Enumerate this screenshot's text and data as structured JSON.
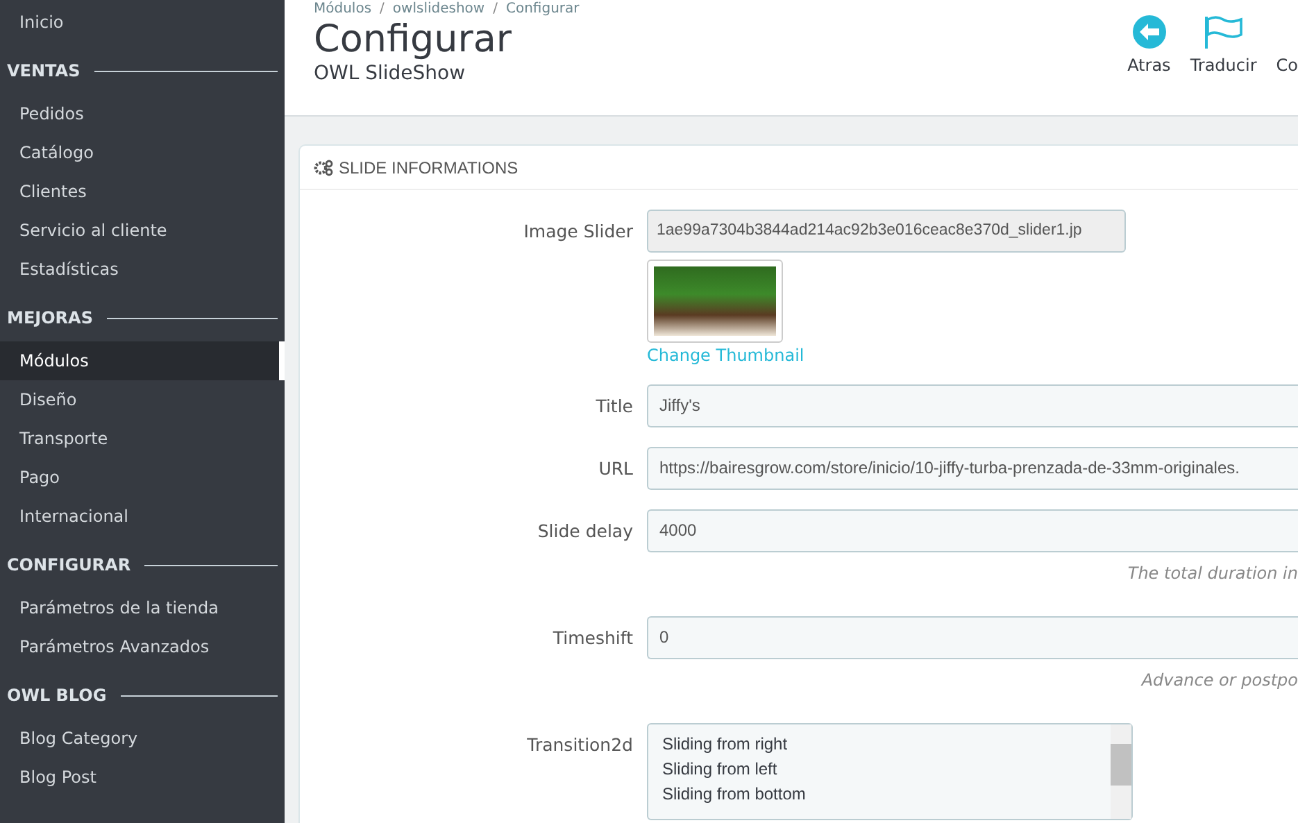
{
  "sidebar": {
    "sections": [
      {
        "items": [
          {
            "label": "Inicio",
            "selected": false
          }
        ]
      },
      {
        "heading": "VENTAS",
        "items": [
          {
            "label": "Pedidos",
            "selected": false
          },
          {
            "label": "Catálogo",
            "selected": false
          },
          {
            "label": "Clientes",
            "selected": false
          },
          {
            "label": "Servicio al cliente",
            "selected": false
          },
          {
            "label": "Estadísticas",
            "selected": false
          }
        ]
      },
      {
        "heading": "MEJORAS",
        "items": [
          {
            "label": "Módulos",
            "selected": true
          },
          {
            "label": "Diseño",
            "selected": false
          },
          {
            "label": "Transporte",
            "selected": false
          },
          {
            "label": "Pago",
            "selected": false
          },
          {
            "label": "Internacional",
            "selected": false
          }
        ]
      },
      {
        "heading": "CONFIGURAR",
        "items": [
          {
            "label": "Parámetros de la tienda",
            "selected": false
          },
          {
            "label": "Parámetros Avanzados",
            "selected": false
          }
        ]
      },
      {
        "heading": "OWL BLOG",
        "items": [
          {
            "label": "Blog Category",
            "selected": false
          },
          {
            "label": "Blog Post",
            "selected": false
          }
        ]
      }
    ]
  },
  "breadcrumb": {
    "separator": "/",
    "items": [
      "Módulos",
      "owlslideshow",
      "Configurar"
    ]
  },
  "header": {
    "title": "Configurar",
    "subtitle": "OWL SlideShow"
  },
  "toolbar": [
    {
      "kind": "back",
      "label": "Atras"
    },
    {
      "kind": "flag",
      "label": "Traducir"
    },
    {
      "kind": "other",
      "label": "Co"
    }
  ],
  "panel": {
    "title": "SLIDE INFORMATIONS",
    "fields": [
      {
        "kind": "file",
        "label": "Image Slider",
        "value": "1ae99a7304b3844ad214ac92b3e016ceac8e370d_slider1.jp",
        "link": "Change Thumbnail"
      },
      {
        "kind": "text",
        "label": "Title",
        "value": "Jiffy's"
      },
      {
        "kind": "text",
        "label": "URL",
        "value": "https://bairesgrow.com/store/inicio/10-jiffy-turba-prenzada-de-33mm-originales."
      },
      {
        "kind": "text",
        "label": "Slide delay",
        "value": "4000",
        "help": "The total duration in"
      },
      {
        "kind": "text",
        "label": "Timeshift",
        "value": "0",
        "help": "Advance or postpo"
      },
      {
        "kind": "list",
        "label": "Transition2d",
        "options": [
          "Sliding from right",
          "Sliding from left",
          "Sliding from bottom"
        ]
      }
    ]
  }
}
